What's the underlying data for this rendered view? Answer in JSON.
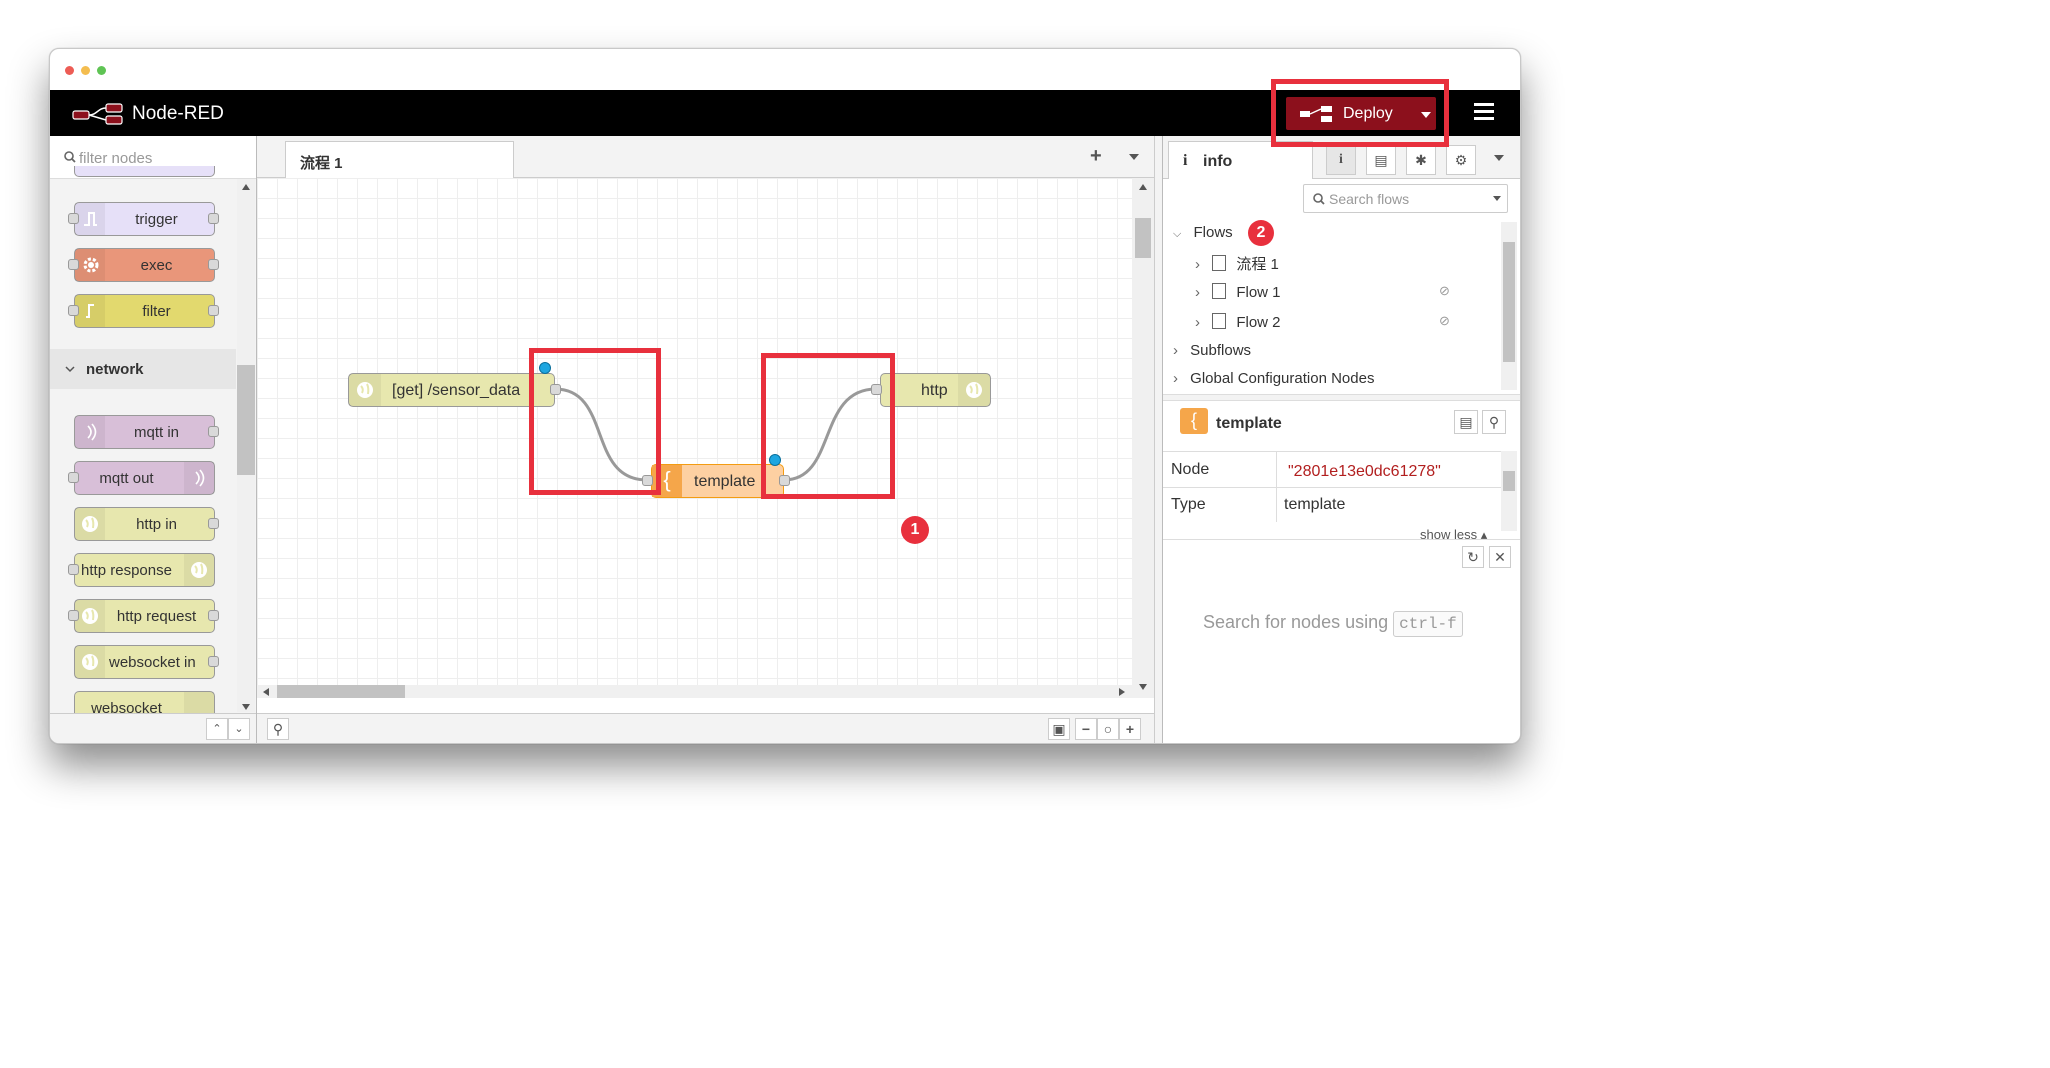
{
  "app": {
    "title": "Node-RED",
    "deploy_label": "Deploy",
    "accent": "#8c101c"
  },
  "palette": {
    "search_placeholder": "filter nodes",
    "function_nodes": [
      {
        "label": "trigger",
        "color": "#e6e0f8",
        "icon": "trigger-icon"
      },
      {
        "label": "exec",
        "color": "#e9967a",
        "icon": "gear-icon"
      },
      {
        "label": "filter",
        "color": "#e2d96e",
        "icon": "filter-icon"
      }
    ],
    "network_category": "network",
    "network_nodes": [
      {
        "label": "mqtt in",
        "color": "#d8bfd8",
        "icon": "mqtt-icon"
      },
      {
        "label": "mqtt out",
        "color": "#d8bfd8",
        "icon": "mqtt-icon"
      },
      {
        "label": "http in",
        "color": "#e7e7ae",
        "icon": "globe-icon"
      },
      {
        "label": "http response",
        "color": "#e7e7ae",
        "icon": "globe-icon"
      },
      {
        "label": "http request",
        "color": "#e7e7ae",
        "icon": "globe-icon"
      },
      {
        "label": "websocket in",
        "color": "#e7e7ae",
        "icon": "globe-icon"
      },
      {
        "label": "websocket",
        "color": "#e7e7ae",
        "icon": "globe-icon"
      }
    ]
  },
  "workspace": {
    "tab_label": "流程 1",
    "nodes": {
      "http_in": "[get] /sensor_data",
      "template": "template",
      "http_response": "http"
    }
  },
  "sidebar": {
    "tab_label": "info",
    "search_placeholder": "Search flows",
    "tree": {
      "flows_label": "Flows",
      "flow_items": [
        "流程 1",
        "Flow 1",
        "Flow 2"
      ],
      "subflows_label": "Subflows",
      "global_config_label": "Global Configuration Nodes"
    },
    "selected": {
      "title": "template",
      "rows": [
        {
          "key": "Node",
          "value": "\"2801e13e0dc61278\""
        },
        {
          "key": "Type",
          "value": "template"
        }
      ],
      "show_less": "show less"
    },
    "help_text": "Search for nodes using",
    "help_kbd": "ctrl-f"
  },
  "annotations": {
    "badge_1": "1",
    "badge_2": "2",
    "highlight_color": "#e8303d"
  }
}
